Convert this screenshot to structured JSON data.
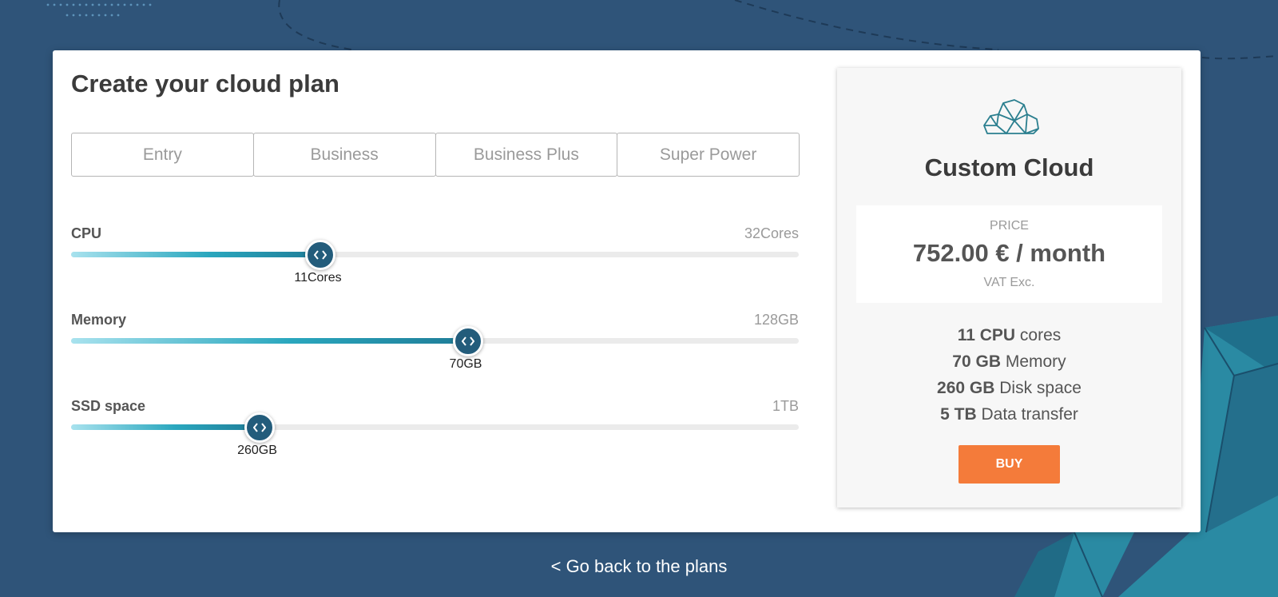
{
  "page": {
    "title": "Create your cloud plan",
    "back_link": "< Go back to the plans"
  },
  "tabs": [
    {
      "label": "Entry"
    },
    {
      "label": "Business"
    },
    {
      "label": "Business Plus"
    },
    {
      "label": "Super Power"
    }
  ],
  "sliders": [
    {
      "label": "CPU",
      "max_label": "32Cores",
      "value_label": "11Cores",
      "value": 11,
      "max": 32
    },
    {
      "label": "Memory",
      "max_label": "128GB",
      "value_label": "70GB",
      "value": 70,
      "max": 128
    },
    {
      "label": "SSD space",
      "max_label": "1TB",
      "value_label": "260GB",
      "value": 260,
      "max": 1000
    }
  ],
  "summary": {
    "icon": "cloud-icon",
    "name": "Custom Cloud",
    "price_label": "PRICE",
    "price_value": "752.00 € / month",
    "price_note": "VAT Exc.",
    "specs": [
      {
        "strong": "11 CPU",
        "rest": " cores"
      },
      {
        "strong": "70 GB",
        "rest": " Memory"
      },
      {
        "strong": "260 GB",
        "rest": " Disk space"
      },
      {
        "strong": "5 TB",
        "rest": " Data transfer"
      }
    ],
    "buy_label": "BUY"
  },
  "colors": {
    "background": "#2f5479",
    "handle": "#235c7b",
    "accent_fill": "#2aa7be",
    "buy_button": "#f47b3a"
  }
}
